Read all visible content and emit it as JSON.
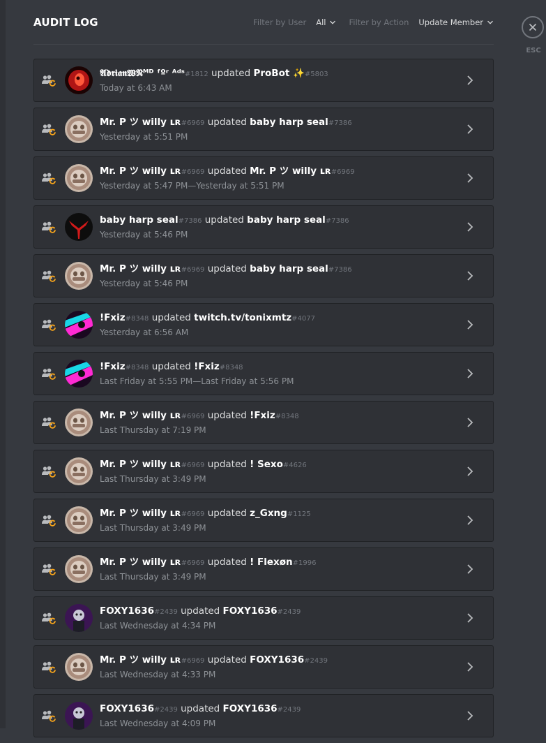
{
  "header": {
    "title": "AUDIT LOG",
    "filter_user_label": "Filter by User",
    "filter_user_value": "All",
    "filter_action_label": "Filter by Action",
    "filter_action_value": "Update Member"
  },
  "close": {
    "esc_label": "ESC"
  },
  "entries": [
    {
      "user": "𝕬𝖉𝖗𝖎𝖆𝖓𝖂𝕹ᴹᴰ ᶠºʳ ᴬᵈˢ",
      "user_disc": "#1812",
      "verb": "updated",
      "target": "ProBot ✨",
      "target_disc": "#5803",
      "time": "Today at 6:43 AM",
      "avatar": "red"
    },
    {
      "user": "Mr. P ツ willy ʟʀ",
      "user_disc": "#6969",
      "verb": "updated",
      "target": "baby harp seal",
      "target_disc": "#7386",
      "time": "Yesterday at 5:51 PM",
      "avatar": "willy"
    },
    {
      "user": "Mr. P ツ willy ʟʀ",
      "user_disc": "#6969",
      "verb": "updated",
      "target": "Mr. P ツ willy ʟʀ",
      "target_disc": "#6969",
      "time": "Yesterday at 5:47 PM—Yesterday at 5:51 PM",
      "avatar": "willy"
    },
    {
      "user": "baby harp seal",
      "user_disc": "#7386",
      "verb": "updated",
      "target": "baby harp seal",
      "target_disc": "#7386",
      "time": "Yesterday at 5:46 PM",
      "avatar": "seal"
    },
    {
      "user": "Mr. P ツ willy ʟʀ",
      "user_disc": "#6969",
      "verb": "updated",
      "target": "baby harp seal",
      "target_disc": "#7386",
      "time": "Yesterday at 5:46 PM",
      "avatar": "willy"
    },
    {
      "user": "!Fxiz",
      "user_disc": "#8348",
      "verb": "updated",
      "target": "twitch.tv/tonixmtz",
      "target_disc": "#4077",
      "time": "Yesterday at 6:56 AM",
      "avatar": "fxiz"
    },
    {
      "user": "!Fxiz",
      "user_disc": "#8348",
      "verb": "updated",
      "target": "!Fxiz",
      "target_disc": "#8348",
      "time": "Last Friday at 5:55 PM—Last Friday at 5:56 PM",
      "avatar": "fxiz"
    },
    {
      "user": "Mr. P ツ willy ʟʀ",
      "user_disc": "#6969",
      "verb": "updated",
      "target": "!Fxiz",
      "target_disc": "#8348",
      "time": "Last Thursday at 7:19 PM",
      "avatar": "willy"
    },
    {
      "user": "Mr. P ツ willy ʟʀ",
      "user_disc": "#6969",
      "verb": "updated",
      "target": "! Sexo",
      "target_disc": "#4626",
      "time": "Last Thursday at 3:49 PM",
      "avatar": "willy"
    },
    {
      "user": "Mr. P ツ willy ʟʀ",
      "user_disc": "#6969",
      "verb": "updated",
      "target": "z_Gxng",
      "target_disc": "#1125",
      "time": "Last Thursday at 3:49 PM",
      "avatar": "willy"
    },
    {
      "user": "Mr. P ツ willy ʟʀ",
      "user_disc": "#6969",
      "verb": "updated",
      "target": "! Flexøn",
      "target_disc": "#1996",
      "time": "Last Thursday at 3:49 PM",
      "avatar": "willy"
    },
    {
      "user": "FOXY1636",
      "user_disc": "#2439",
      "verb": "updated",
      "target": "FOXY1636",
      "target_disc": "#2439",
      "time": "Last Wednesday at 4:34 PM",
      "avatar": "foxy"
    },
    {
      "user": "Mr. P ツ willy ʟʀ",
      "user_disc": "#6969",
      "verb": "updated",
      "target": "FOXY1636",
      "target_disc": "#2439",
      "time": "Last Wednesday at 4:33 PM",
      "avatar": "willy"
    },
    {
      "user": "FOXY1636",
      "user_disc": "#2439",
      "verb": "updated",
      "target": "FOXY1636",
      "target_disc": "#2439",
      "time": "Last Wednesday at 4:09 PM",
      "avatar": "foxy"
    }
  ]
}
